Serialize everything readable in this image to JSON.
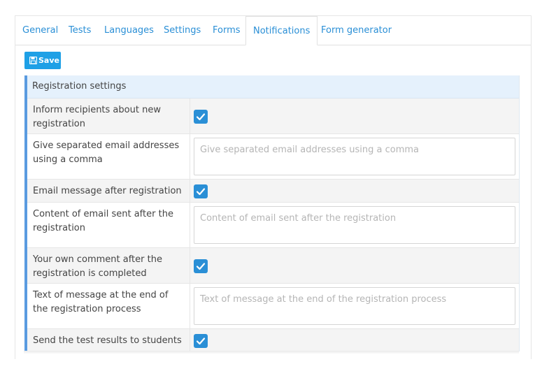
{
  "tabs": [
    {
      "label": "General"
    },
    {
      "label": "Tests"
    },
    {
      "label": "Languages"
    },
    {
      "label": "Settings"
    },
    {
      "label": "Forms"
    },
    {
      "label": "Notifications",
      "active": true
    },
    {
      "label": "Form generator"
    }
  ],
  "save_button": {
    "label": "Save",
    "icon": "floppy-disk-icon"
  },
  "panel": {
    "title": "Registration settings",
    "rows": [
      {
        "label": "Inform recipients about new registration",
        "type": "checkbox",
        "checked": true
      },
      {
        "label": "Give separated email addresses using a comma",
        "type": "text",
        "placeholder": "Give separated email addresses using a comma",
        "value": ""
      },
      {
        "label": "Email message after registration",
        "type": "checkbox",
        "checked": true
      },
      {
        "label": "Content of email sent after the registration",
        "type": "text",
        "placeholder": "Content of email sent after the registration",
        "value": ""
      },
      {
        "label": "Your own comment after the registration is completed",
        "type": "checkbox",
        "checked": true
      },
      {
        "label": "Text of message at the end of the registration process",
        "type": "text",
        "placeholder": "Text of message at the end of the registration process",
        "value": ""
      },
      {
        "label": "Send the test results to students",
        "type": "checkbox",
        "checked": true
      }
    ]
  },
  "colors": {
    "accent": "#2a8fd6",
    "button": "#1ea0e6",
    "panel_header": "#e5f1fc",
    "panel_border": "#5a9be0"
  }
}
